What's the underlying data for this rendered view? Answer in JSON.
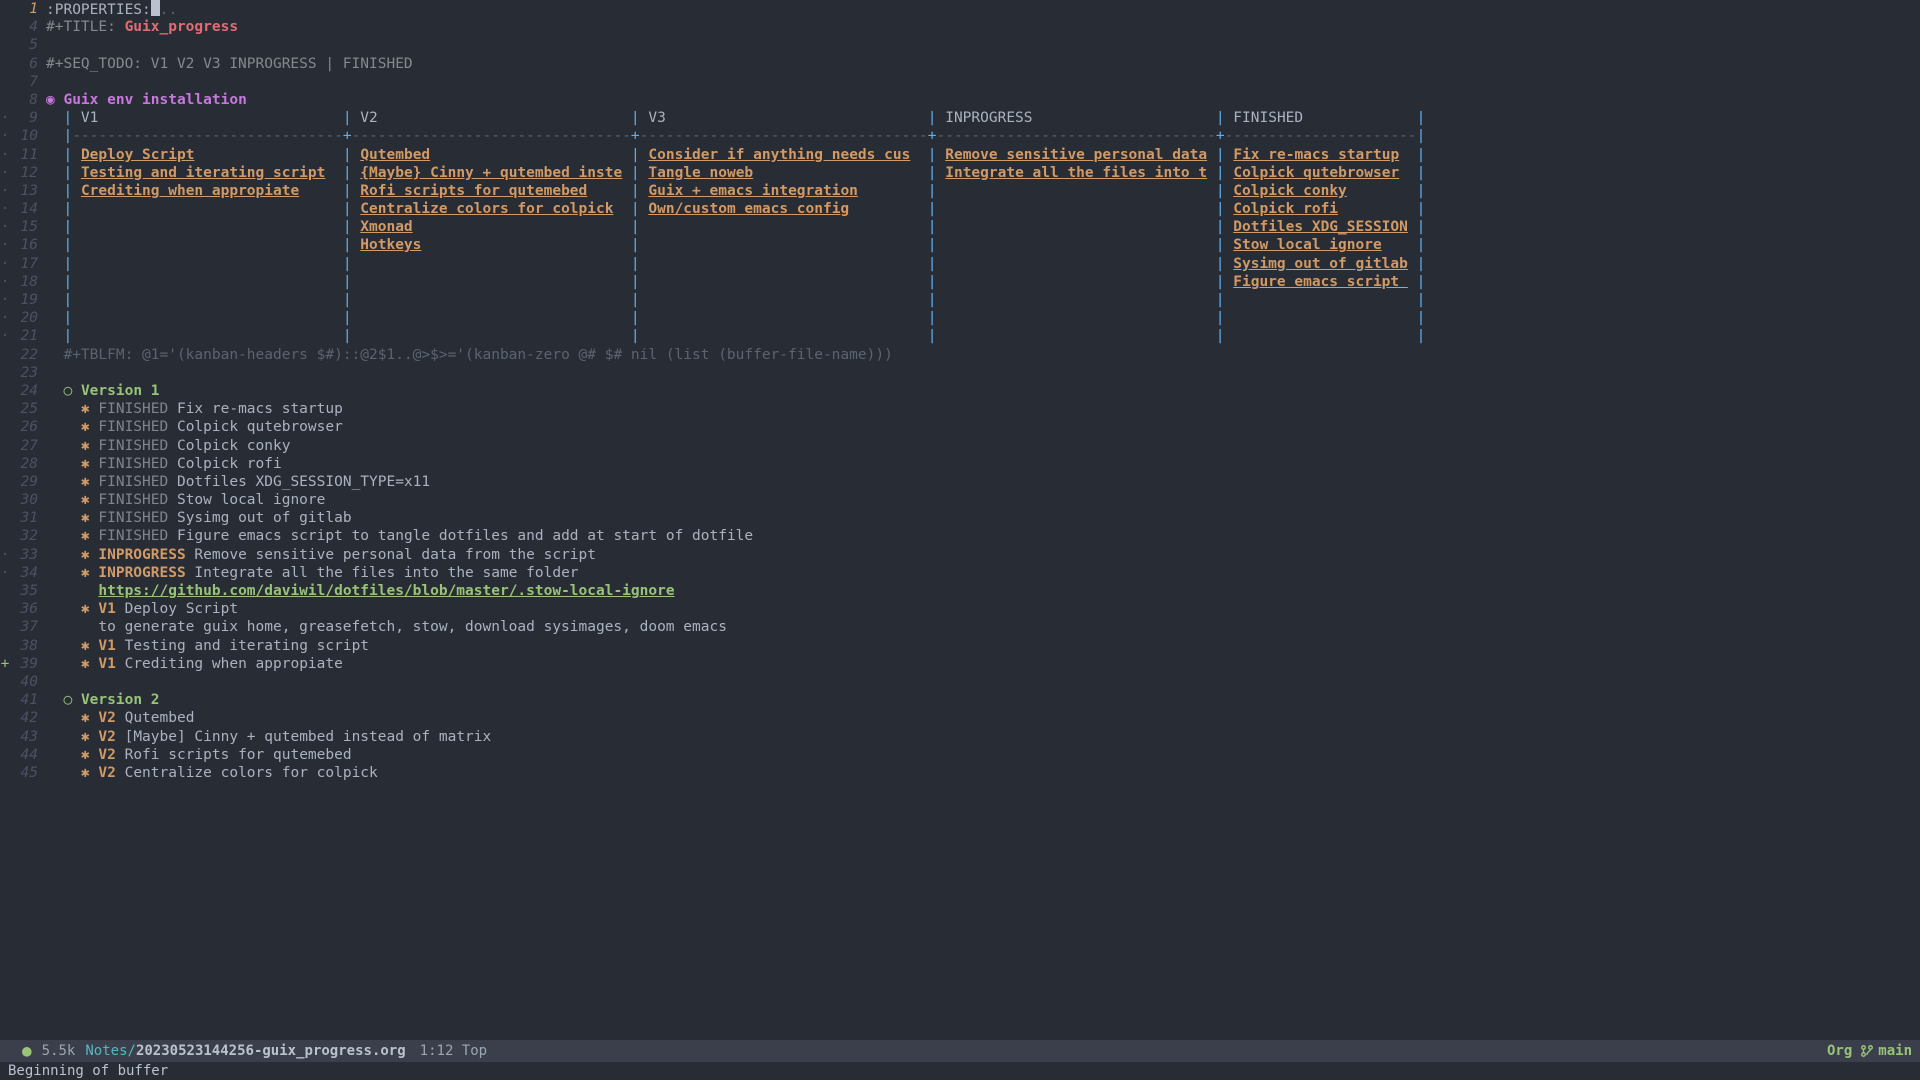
{
  "gutter": {
    "current": 1,
    "dots": [
      9,
      10,
      11,
      12,
      13,
      14,
      15,
      16,
      17,
      18,
      19,
      20,
      21,
      33,
      34
    ],
    "plus": [
      39
    ]
  },
  "lines": [
    {
      "n": 1,
      "seg": [
        {
          "c": "kw-prop",
          "t": ":PROPERTIES:"
        },
        {
          "c": "cursor",
          "t": ""
        },
        {
          "c": "dim",
          "t": ".."
        }
      ]
    },
    {
      "n": 4,
      "seg": [
        {
          "c": "title-kw",
          "t": "#+TITLE: "
        },
        {
          "c": "title-val",
          "t": "Guix_progress"
        }
      ]
    },
    {
      "n": 5,
      "seg": []
    },
    {
      "n": 6,
      "seg": [
        {
          "c": "title-kw",
          "t": "#+SEQ_TODO: V1 V2 V3 INPROGRESS | FINISHED"
        }
      ]
    },
    {
      "n": 7,
      "seg": []
    },
    {
      "n": 8,
      "seg": [
        {
          "c": "h1-bullet",
          "t": "◉ "
        },
        {
          "c": "h1-text",
          "t": "Guix env installation"
        }
      ]
    },
    {
      "n": 9,
      "seg": [
        {
          "c": "txt",
          "t": "  "
        },
        {
          "c": "tbl",
          "t": "|"
        },
        {
          "c": "tbl-head",
          "t": " V1                            "
        },
        {
          "c": "tbl",
          "t": "|"
        },
        {
          "c": "tbl-head",
          "t": " V2                             "
        },
        {
          "c": "tbl",
          "t": "|"
        },
        {
          "c": "tbl-head",
          "t": " V3                              "
        },
        {
          "c": "tbl",
          "t": "|"
        },
        {
          "c": "tbl-head",
          "t": " INPROGRESS                     "
        },
        {
          "c": "tbl",
          "t": "|"
        },
        {
          "c": "tbl-head",
          "t": " FINISHED             "
        },
        {
          "c": "tbl",
          "t": "|"
        }
      ]
    },
    {
      "n": 10,
      "seg": [
        {
          "c": "txt",
          "t": "  "
        },
        {
          "c": "tbl",
          "t": "|"
        },
        {
          "c": "dash",
          "t": "-------------------------------"
        },
        {
          "c": "tbl",
          "t": "+"
        },
        {
          "c": "dash",
          "t": "--------------------------------"
        },
        {
          "c": "tbl",
          "t": "+"
        },
        {
          "c": "dash",
          "t": "---------------------------------"
        },
        {
          "c": "tbl",
          "t": "+"
        },
        {
          "c": "dash",
          "t": "--------------------------------"
        },
        {
          "c": "tbl",
          "t": "+"
        },
        {
          "c": "dash",
          "t": "----------------------"
        },
        {
          "c": "tbl",
          "t": "|"
        }
      ]
    },
    {
      "n": 11,
      "seg": [
        {
          "c": "txt",
          "t": "  "
        },
        {
          "c": "tbl",
          "t": "| "
        },
        {
          "c": "link",
          "t": "Deploy Script"
        },
        {
          "c": "tbl",
          "t": "                 | "
        },
        {
          "c": "link",
          "t": "Qutembed"
        },
        {
          "c": "tbl",
          "t": "                       | "
        },
        {
          "c": "link",
          "t": "Consider if anything needs cus"
        },
        {
          "c": "tbl",
          "t": "  | "
        },
        {
          "c": "link",
          "t": "Remove sensitive personal data"
        },
        {
          "c": "tbl",
          "t": " | "
        },
        {
          "c": "link",
          "t": "Fix re-macs startup"
        },
        {
          "c": "tbl",
          "t": "  |"
        }
      ]
    },
    {
      "n": 12,
      "seg": [
        {
          "c": "txt",
          "t": "  "
        },
        {
          "c": "tbl",
          "t": "| "
        },
        {
          "c": "link",
          "t": "Testing and iterating script"
        },
        {
          "c": "tbl",
          "t": "  | "
        },
        {
          "c": "link",
          "t": "{Maybe} Cinny + qutembed inste"
        },
        {
          "c": "tbl",
          "t": " | "
        },
        {
          "c": "link",
          "t": "Tangle noweb"
        },
        {
          "c": "tbl",
          "t": "                    | "
        },
        {
          "c": "link",
          "t": "Integrate all the files into t"
        },
        {
          "c": "tbl",
          "t": " | "
        },
        {
          "c": "link",
          "t": "Colpick qutebrowser"
        },
        {
          "c": "tbl",
          "t": "  |"
        }
      ]
    },
    {
      "n": 13,
      "seg": [
        {
          "c": "txt",
          "t": "  "
        },
        {
          "c": "tbl",
          "t": "| "
        },
        {
          "c": "link",
          "t": "Crediting when appropiate"
        },
        {
          "c": "tbl",
          "t": "     | "
        },
        {
          "c": "link",
          "t": "Rofi scripts for qutemebed"
        },
        {
          "c": "tbl",
          "t": "     | "
        },
        {
          "c": "link",
          "t": "Guix + emacs integration"
        },
        {
          "c": "tbl",
          "t": "        |                                | "
        },
        {
          "c": "link",
          "t": "Colpick conky"
        },
        {
          "c": "tbl",
          "t": "        |"
        }
      ]
    },
    {
      "n": 14,
      "seg": [
        {
          "c": "txt",
          "t": "  "
        },
        {
          "c": "tbl",
          "t": "|                               | "
        },
        {
          "c": "link",
          "t": "Centralize colors for colpick"
        },
        {
          "c": "tbl",
          "t": "  | "
        },
        {
          "c": "link",
          "t": "Own/custom emacs config"
        },
        {
          "c": "tbl",
          "t": "         |                                | "
        },
        {
          "c": "link",
          "t": "Colpick rofi"
        },
        {
          "c": "tbl",
          "t": "         |"
        }
      ]
    },
    {
      "n": 15,
      "seg": [
        {
          "c": "txt",
          "t": "  "
        },
        {
          "c": "tbl",
          "t": "|                               | "
        },
        {
          "c": "link",
          "t": "Xmonad"
        },
        {
          "c": "tbl",
          "t": "                         |                                 |                                | "
        },
        {
          "c": "link",
          "t": "Dotfiles XDG_SESSION"
        },
        {
          "c": "tbl",
          "t": " |"
        }
      ]
    },
    {
      "n": 16,
      "seg": [
        {
          "c": "txt",
          "t": "  "
        },
        {
          "c": "tbl",
          "t": "|                               | "
        },
        {
          "c": "link",
          "t": "Hotkeys"
        },
        {
          "c": "tbl",
          "t": "                        |                                 |                                | "
        },
        {
          "c": "link",
          "t": "Stow local ignore"
        },
        {
          "c": "tbl",
          "t": "    |"
        }
      ]
    },
    {
      "n": 17,
      "seg": [
        {
          "c": "txt",
          "t": "  "
        },
        {
          "c": "tbl",
          "t": "|                               |                                |                                 |                                | "
        },
        {
          "c": "link",
          "t": "Sysimg out of gitlab"
        },
        {
          "c": "tbl",
          "t": " |"
        }
      ]
    },
    {
      "n": 18,
      "seg": [
        {
          "c": "txt",
          "t": "  "
        },
        {
          "c": "tbl",
          "t": "|                               |                                |                                 |                                | "
        },
        {
          "c": "link",
          "t": "Figure emacs script "
        },
        {
          "c": "tbl",
          "t": " |"
        }
      ]
    },
    {
      "n": 19,
      "seg": [
        {
          "c": "txt",
          "t": "  "
        },
        {
          "c": "tbl",
          "t": "|                               |                                |                                 |                                |                      |"
        }
      ]
    },
    {
      "n": 20,
      "seg": [
        {
          "c": "txt",
          "t": "  "
        },
        {
          "c": "tbl",
          "t": "|                               |                                |                                 |                                |                      |"
        }
      ]
    },
    {
      "n": 21,
      "seg": [
        {
          "c": "txt",
          "t": "  "
        },
        {
          "c": "tbl",
          "t": "|                               |                                |                                 |                                |                      |"
        }
      ]
    },
    {
      "n": 22,
      "seg": [
        {
          "c": "txt",
          "t": "  "
        },
        {
          "c": "comment",
          "t": "#+TBLFM: @1='(kanban-headers $#)::@2$1..@>$>='(kanban-zero @# $# nil (list (buffer-file-name)))"
        }
      ]
    },
    {
      "n": 23,
      "seg": []
    },
    {
      "n": 24,
      "seg": [
        {
          "c": "txt",
          "t": "  "
        },
        {
          "c": "h2-bullet",
          "t": "○ "
        },
        {
          "c": "h2-text",
          "t": "Version 1"
        }
      ]
    },
    {
      "n": 25,
      "seg": [
        {
          "c": "txt",
          "t": "    "
        },
        {
          "c": "h3-bullet",
          "t": "✱ "
        },
        {
          "c": "kw-finished",
          "t": "FINISHED "
        },
        {
          "c": "h3-text",
          "t": "Fix re-macs startup"
        }
      ]
    },
    {
      "n": 26,
      "seg": [
        {
          "c": "txt",
          "t": "    "
        },
        {
          "c": "h3-bullet",
          "t": "✱ "
        },
        {
          "c": "kw-finished",
          "t": "FINISHED "
        },
        {
          "c": "h3-text",
          "t": "Colpick qutebrowser"
        }
      ]
    },
    {
      "n": 27,
      "seg": [
        {
          "c": "txt",
          "t": "    "
        },
        {
          "c": "h3-bullet",
          "t": "✱ "
        },
        {
          "c": "kw-finished",
          "t": "FINISHED "
        },
        {
          "c": "h3-text",
          "t": "Colpick conky"
        }
      ]
    },
    {
      "n": 28,
      "seg": [
        {
          "c": "txt",
          "t": "    "
        },
        {
          "c": "h3-bullet",
          "t": "✱ "
        },
        {
          "c": "kw-finished",
          "t": "FINISHED "
        },
        {
          "c": "h3-text",
          "t": "Colpick rofi"
        }
      ]
    },
    {
      "n": 29,
      "seg": [
        {
          "c": "txt",
          "t": "    "
        },
        {
          "c": "h3-bullet",
          "t": "✱ "
        },
        {
          "c": "kw-finished",
          "t": "FINISHED "
        },
        {
          "c": "h3-text",
          "t": "Dotfiles XDG_SESSION_TYPE=x11"
        }
      ]
    },
    {
      "n": 30,
      "seg": [
        {
          "c": "txt",
          "t": "    "
        },
        {
          "c": "h3-bullet",
          "t": "✱ "
        },
        {
          "c": "kw-finished",
          "t": "FINISHED "
        },
        {
          "c": "h3-text",
          "t": "Stow local ignore"
        }
      ]
    },
    {
      "n": 31,
      "seg": [
        {
          "c": "txt",
          "t": "    "
        },
        {
          "c": "h3-bullet",
          "t": "✱ "
        },
        {
          "c": "kw-finished",
          "t": "FINISHED "
        },
        {
          "c": "h3-text",
          "t": "Sysimg out of gitlab"
        }
      ]
    },
    {
      "n": 32,
      "seg": [
        {
          "c": "txt",
          "t": "    "
        },
        {
          "c": "h3-bullet",
          "t": "✱ "
        },
        {
          "c": "kw-finished",
          "t": "FINISHED "
        },
        {
          "c": "h3-text",
          "t": "Figure emacs script to tangle dotfiles and add at start of dotfile"
        }
      ]
    },
    {
      "n": 33,
      "seg": [
        {
          "c": "txt",
          "t": "    "
        },
        {
          "c": "h3-bullet",
          "t": "✱ "
        },
        {
          "c": "kw-inprog",
          "t": "INPROGRESS "
        },
        {
          "c": "h3-text",
          "t": "Remove sensitive personal data from the script"
        }
      ]
    },
    {
      "n": 34,
      "seg": [
        {
          "c": "txt",
          "t": "    "
        },
        {
          "c": "h3-bullet",
          "t": "✱ "
        },
        {
          "c": "kw-inprog",
          "t": "INPROGRESS "
        },
        {
          "c": "h3-text",
          "t": "Integrate all the files into the same folder"
        }
      ]
    },
    {
      "n": 35,
      "seg": [
        {
          "c": "txt",
          "t": "      "
        },
        {
          "c": "url",
          "t": "https://github.com/daviwil/dotfiles/blob/master/.stow-local-ignore"
        }
      ]
    },
    {
      "n": 36,
      "seg": [
        {
          "c": "txt",
          "t": "    "
        },
        {
          "c": "h3-bullet",
          "t": "✱ "
        },
        {
          "c": "kw-v",
          "t": "V1 "
        },
        {
          "c": "h3-text",
          "t": "Deploy Script"
        }
      ]
    },
    {
      "n": 37,
      "seg": [
        {
          "c": "txt",
          "t": "      to generate guix home, greasefetch, stow, download sysimages, doom emacs"
        }
      ]
    },
    {
      "n": 38,
      "seg": [
        {
          "c": "txt",
          "t": "    "
        },
        {
          "c": "h3-bullet",
          "t": "✱ "
        },
        {
          "c": "kw-v",
          "t": "V1 "
        },
        {
          "c": "h3-text",
          "t": "Testing and iterating script"
        }
      ]
    },
    {
      "n": 39,
      "seg": [
        {
          "c": "txt",
          "t": "    "
        },
        {
          "c": "h3-bullet",
          "t": "✱ "
        },
        {
          "c": "kw-v",
          "t": "V1 "
        },
        {
          "c": "h3-text",
          "t": "Crediting when appropiate"
        }
      ]
    },
    {
      "n": 40,
      "seg": []
    },
    {
      "n": 41,
      "seg": [
        {
          "c": "txt",
          "t": "  "
        },
        {
          "c": "h2-bullet",
          "t": "○ "
        },
        {
          "c": "h2-text",
          "t": "Version 2"
        }
      ]
    },
    {
      "n": 42,
      "seg": [
        {
          "c": "txt",
          "t": "    "
        },
        {
          "c": "h3-bullet",
          "t": "✱ "
        },
        {
          "c": "kw-v",
          "t": "V2 "
        },
        {
          "c": "h3-text",
          "t": "Qutembed"
        }
      ]
    },
    {
      "n": 43,
      "seg": [
        {
          "c": "txt",
          "t": "    "
        },
        {
          "c": "h3-bullet",
          "t": "✱ "
        },
        {
          "c": "kw-v",
          "t": "V2 "
        },
        {
          "c": "h3-text",
          "t": "[Maybe] Cinny + qutembed instead of matrix"
        }
      ]
    },
    {
      "n": 44,
      "seg": [
        {
          "c": "txt",
          "t": "    "
        },
        {
          "c": "h3-bullet",
          "t": "✱ "
        },
        {
          "c": "kw-v",
          "t": "V2 "
        },
        {
          "c": "h3-text",
          "t": "Rofi scripts for qutemebed"
        }
      ]
    },
    {
      "n": 45,
      "seg": [
        {
          "c": "txt",
          "t": "    "
        },
        {
          "c": "h3-bullet",
          "t": "✱ "
        },
        {
          "c": "kw-v",
          "t": "V2 "
        },
        {
          "c": "h3-text",
          "t": "Centralize colors for colpick"
        }
      ]
    }
  ],
  "modeline": {
    "size": "5.5k",
    "dir": "Notes/",
    "file": "20230523144256-guix_progress.org",
    "pos": "1:12 Top",
    "mode": "Org",
    "branch": "main"
  },
  "echo": {
    "msg": "Beginning of buffer"
  }
}
